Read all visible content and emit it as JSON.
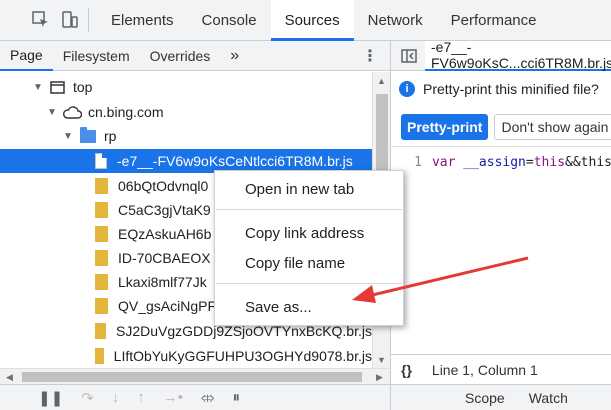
{
  "toolbar": {
    "tabs": [
      "Elements",
      "Console",
      "Sources",
      "Network",
      "Performance"
    ],
    "active_tab": "Sources"
  },
  "navigator": {
    "tabs": [
      "Page",
      "Filesystem",
      "Overrides"
    ],
    "more": "»"
  },
  "tree": {
    "top": "top",
    "domain": "cn.bing.com",
    "folder": "rp",
    "files": [
      "-e7__-FV6w9oKsCeNtlcci6TR8M.br.js",
      "06bQtOdvnql0",
      "C5aC3gjVtaK9",
      "EQzAskuAH6b",
      "ID-70CBAEOX",
      "Lkaxi8mlf77Jk",
      "QV_gsAciNgPF",
      "SJ2DuVgzGDDj9ZSjoOVTYnxBcKQ.br.js",
      "LIftObYuKyGGFUHPU3OGHYd9078.br.js"
    ]
  },
  "context_menu": {
    "open_in_new_tab": "Open in new tab",
    "copy_link_address": "Copy link address",
    "copy_file_name": "Copy file name",
    "save_as": "Save as..."
  },
  "editor": {
    "file_tab": "-e7__-FV6w9oKsC...cci6TR8M.br.js",
    "info_text": "Pretty-print this minified file?",
    "pretty_print_button": "Pretty-print",
    "dont_show_button": "Don't show again",
    "line_number": "1",
    "code_kw1": "var",
    "code_id": "__assign",
    "code_op": "=",
    "code_kw2": "this",
    "code_rest": "&&this",
    "status": "Line 1, Column 1",
    "bottom_tabs": [
      "Scope",
      "Watch"
    ]
  },
  "colors": {
    "accent": "#1a73e8",
    "annotation_arrow": "#e53935"
  }
}
